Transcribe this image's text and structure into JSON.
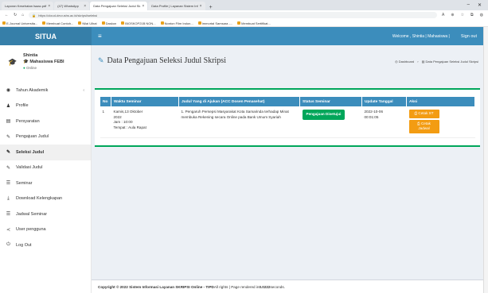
{
  "browser": {
    "tabs": [
      {
        "label": "Laporan Kesehatan Isaac.pdf",
        "active": false
      },
      {
        "label": "(47) WhatsApp",
        "active": false
      },
      {
        "label": "Data Pengajuan Seleksi Judul Sk",
        "active": true
      },
      {
        "label": "Data Profile | Layanan Sistem Inf",
        "active": false
      }
    ],
    "new_tab": "+",
    "url": "https://cloud-dev.ushs.ac.id/skripsi/seleksi",
    "bookmarks": [
      "E-Journal Universita...",
      "Membuat Contoh...",
      "Nilai Ulhat",
      "Daskon",
      "BIOSKOP21B NON...",
      "Nonton Film Indon...",
      "Immortal Samsara -...",
      "Membuat Sertifikat..."
    ]
  },
  "app": {
    "brand": "SITUA",
    "welcome": "Welcome , Shintia | Mahasiswa |",
    "signout": "Sign out"
  },
  "user": {
    "name": "Shintia",
    "role": "Mahasiswa FEBI",
    "status": "Online"
  },
  "menu": [
    {
      "label": "Tahun Akademik",
      "icon": "gauge-icon",
      "glyph": "◉",
      "chevron": true,
      "active": false
    },
    {
      "label": "Profile",
      "icon": "user-icon",
      "glyph": "♟",
      "chevron": false,
      "active": false
    },
    {
      "label": "Persyaratan",
      "icon": "file-icon",
      "glyph": "▤",
      "chevron": false,
      "active": false
    },
    {
      "label": "Pengajuan Judul",
      "icon": "edit-icon",
      "glyph": "✎",
      "chevron": false,
      "active": false
    },
    {
      "label": "Seleksi Judul",
      "icon": "edit-icon",
      "glyph": "✎",
      "chevron": false,
      "active": true
    },
    {
      "label": "Validasi Judul",
      "icon": "edit-icon",
      "glyph": "✎",
      "chevron": false,
      "active": false
    },
    {
      "label": "Seminar",
      "icon": "list-icon",
      "glyph": "☰",
      "chevron": false,
      "active": false
    },
    {
      "label": "Download Kelengkapan",
      "icon": "download-icon",
      "glyph": "⤓",
      "chevron": false,
      "active": false
    },
    {
      "label": "Jadwal Seminar",
      "icon": "list-icon",
      "glyph": "☰",
      "chevron": false,
      "active": false
    },
    {
      "label": "User pengguna",
      "icon": "share-icon",
      "glyph": "≺",
      "chevron": false,
      "active": false
    },
    {
      "label": "Log Out",
      "icon": "power-icon",
      "glyph": "⏻",
      "chevron": false,
      "active": false
    }
  ],
  "page": {
    "title": "Data Pengajuan Seleksi Judul Skripsi",
    "breadcrumb_home": "Dashboard",
    "breadcrumb_current": "Data Pengajuan Seleksi Judul Skripsi"
  },
  "table": {
    "headers": [
      "No",
      "Waktu Seminar",
      "Judul Yang di Ajukan (ACC Dosen Penasehat)",
      "Status Seminar",
      "Update Tanggal",
      "Aksi"
    ],
    "rows": [
      {
        "no": "1",
        "waktu_line1": "Kamis,13 Oktober",
        "waktu_line2": "2022",
        "waktu_line3": "Jam : 10:00",
        "waktu_line4": "Tempat : Aula Rapat",
        "judul": "1. Pengaruh Persepsi Masyarakat Kota Samarinda terhadap Minat membuka Rekening secara Online pada Bank Umum Syariah",
        "status": "Pengajuan Disetujui",
        "update_date": "2022-10-06",
        "update_time": "00:01:05",
        "aksi_1": "Cetak ST",
        "aksi_2": "Cetak Jadwal"
      }
    ]
  },
  "footer": {
    "bold": "Copyright © 2022 Sistem Informasi Layanan SKRIPSI Online - TIPD",
    "rest": " All rights | Page rendered in ",
    "time": "0.0222",
    "suffix": " seconds."
  },
  "colors": {
    "brand_dark": "#367fa9",
    "brand": "#3c8dbc",
    "success": "#00a65a",
    "warning": "#f39c12"
  }
}
